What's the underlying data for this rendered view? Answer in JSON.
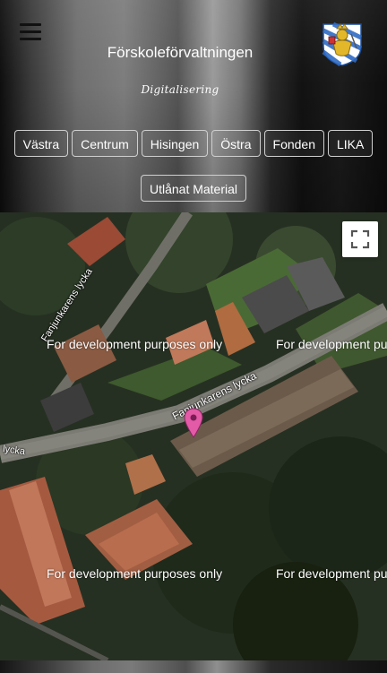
{
  "header": {
    "title": "Förskoleförvaltningen",
    "subtitle": "Digitalisering",
    "menu_icon": "hamburger-menu-icon",
    "logo_icon": "gothenburg-coat-of-arms-icon"
  },
  "nav": {
    "items": [
      {
        "label": "Västra"
      },
      {
        "label": "Centrum"
      },
      {
        "label": "Hisingen"
      },
      {
        "label": "Östra"
      },
      {
        "label": "Fonden"
      },
      {
        "label": "LIKA"
      },
      {
        "label": "Utlånat Material"
      }
    ]
  },
  "map": {
    "fullscreen_icon": "fullscreen-icon",
    "watermark": "For development purposes only",
    "streets": [
      "Fanjunkarens lycka",
      "Fanjunkarens lycka",
      "lycka"
    ],
    "marker_icon": "map-pin-icon",
    "marker_color": "#e35aa6"
  }
}
